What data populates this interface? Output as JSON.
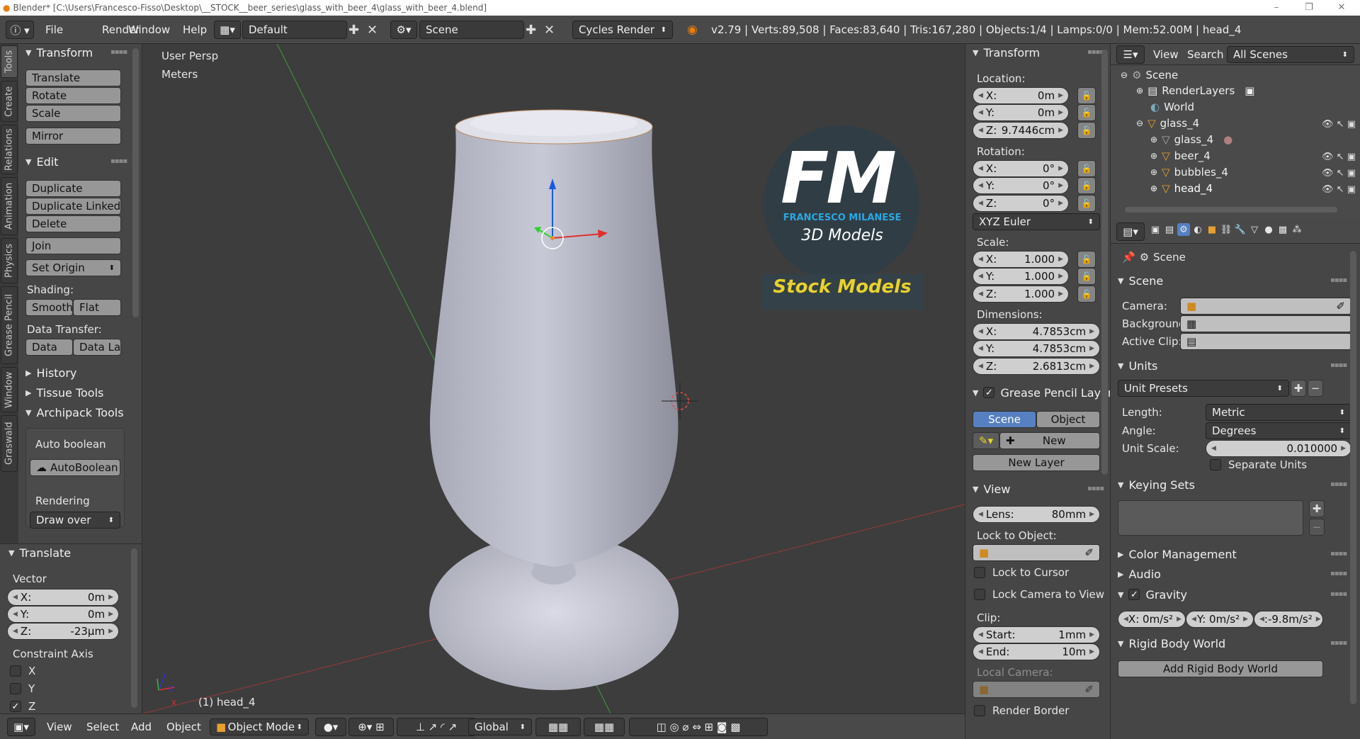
{
  "window": {
    "title": "Blender* [C:\\Users\\Francesco-Fisso\\Desktop\\__STOCK__beer_series\\glass_with_beer_4\\glass_with_beer_4.blend]",
    "minimize": "–",
    "maximize": "❐",
    "close": "✕"
  },
  "info": {
    "menus": [
      "File",
      "Render",
      "Window",
      "Help"
    ],
    "layout": "Default",
    "scene": "Scene",
    "engine": "Cycles Render",
    "stats": "v2.79 | Verts:89,508 | Faces:83,640 | Tris:167,280 | Objects:1/4 | Lamps:0/0 | Mem:52.00M | head_4"
  },
  "tabs": [
    "Tools",
    "Create",
    "Relations",
    "Animation",
    "Physics",
    "Grease Pencil",
    "Window",
    "Graswald"
  ],
  "tools": {
    "transform_title": "Transform",
    "translate": "Translate",
    "rotate": "Rotate",
    "scale": "Scale",
    "mirror": "Mirror",
    "edit_title": "Edit",
    "duplicate": "Duplicate",
    "duplicate_linked": "Duplicate Linked",
    "delete": "Delete",
    "join": "Join",
    "set_origin": "Set Origin",
    "shading_label": "Shading:",
    "smooth": "Smooth",
    "flat": "Flat",
    "data_transfer_label": "Data Transfer:",
    "data": "Data",
    "data_la": "Data La",
    "history": "History",
    "tissue": "Tissue Tools",
    "archipack": "Archipack Tools",
    "auto_boolean_label": "Auto boolean",
    "auto_boolean_btn": "AutoBoolean",
    "rendering_label": "Rendering",
    "draw_over": "Draw over"
  },
  "operator": {
    "title": "Translate",
    "vector_label": "Vector",
    "x_label": "X:",
    "x_val": "0m",
    "y_label": "Y:",
    "y_val": "0m",
    "z_label": "Z:",
    "z_val": "-23µm",
    "constraint_label": "Constraint Axis",
    "cx": "X",
    "cy": "Y",
    "cz": "Z",
    "cz_check": "✓"
  },
  "viewport": {
    "view_name": "User Persp",
    "units": "Meters",
    "object_label": "(1) head_4",
    "logo_letters": "FM",
    "logo_name": "FRANCESCO MILANESE",
    "logo_sub": "3D Models",
    "stock": "Stock Models",
    "axis_x": "X",
    "axis_z": "Z"
  },
  "bottombar": {
    "view": "View",
    "select": "Select",
    "add": "Add",
    "object": "Object",
    "mode": "Object Mode",
    "orientation": "Global"
  },
  "npanel": {
    "transform_title": "Transform",
    "location_label": "Location:",
    "loc_x_label": "X:",
    "loc_x": "0m",
    "loc_y_label": "Y:",
    "loc_y": "0m",
    "loc_z_label": "Z:",
    "loc_z": "9.7446cm",
    "rotation_label": "Rotation:",
    "rot_x_label": "X:",
    "rot_x": "0°",
    "rot_y_label": "Y:",
    "rot_y": "0°",
    "rot_z_label": "Z:",
    "rot_z": "0°",
    "rot_mode": "XYZ Euler",
    "scale_label": "Scale:",
    "sc_x_label": "X:",
    "sc_x": "1.000",
    "sc_y_label": "Y:",
    "sc_y": "1.000",
    "sc_z_label": "Z:",
    "sc_z": "1.000",
    "dim_label": "Dimensions:",
    "dim_x_label": "X:",
    "dim_x": "4.7853cm",
    "dim_y_label": "Y:",
    "dim_y": "4.7853cm",
    "dim_z_label": "Z:",
    "dim_z": "2.6813cm",
    "gp_title": "Grease Pencil Layer",
    "gp_scene": "Scene",
    "gp_object": "Object",
    "gp_new": "New",
    "gp_new_layer": "New Layer",
    "view_title": "View",
    "lens_label": "Lens:",
    "lens": "80mm",
    "lock_label": "Lock to Object:",
    "lock_cursor": "Lock to Cursor",
    "lock_camera": "Lock Camera to View",
    "clip_label": "Clip:",
    "start_label": "Start:",
    "start": "1mm",
    "end_label": "End:",
    "end": "10m",
    "local_camera": "Local Camera:",
    "render_border": "Render Border"
  },
  "outliner": {
    "view": "View",
    "search": "Search",
    "filter": "All Scenes",
    "rows": [
      {
        "name": "Scene"
      },
      {
        "name": "RenderLayers"
      },
      {
        "name": "World"
      },
      {
        "name": "glass_4"
      },
      {
        "name": "glass_4"
      },
      {
        "name": "beer_4"
      },
      {
        "name": "bubbles_4"
      },
      {
        "name": "head_4"
      }
    ]
  },
  "properties": {
    "context": "Scene",
    "scene_title": "Scene",
    "camera_label": "Camera:",
    "background_label": "Background:",
    "active_clip_label": "Active Clip:",
    "units_title": "Units",
    "unit_presets": "Unit Presets",
    "length_label": "Length:",
    "length": "Metric",
    "angle_label": "Angle:",
    "angle": "Degrees",
    "unit_scale_label": "Unit Scale:",
    "unit_scale": "0.010000",
    "separate_units": "Separate Units",
    "keying_title": "Keying Sets",
    "color_mgmt": "Color Management",
    "audio": "Audio",
    "gravity_title": "Gravity",
    "gx": "X:  0m/s²",
    "gy": "Y:  0m/s²",
    "gz": ":-9.8m/s²",
    "rigid_title": "Rigid Body World",
    "add_rigid": "Add Rigid Body World"
  },
  "colors": {
    "viewport_bg": "#3d3d3d",
    "panel_bg": "#464646",
    "accent_blue": "#5680c2",
    "stock_yellow": "#e8d22a",
    "logo_blue": "#2aa8e0",
    "logo_circle": "#2f3d45"
  }
}
